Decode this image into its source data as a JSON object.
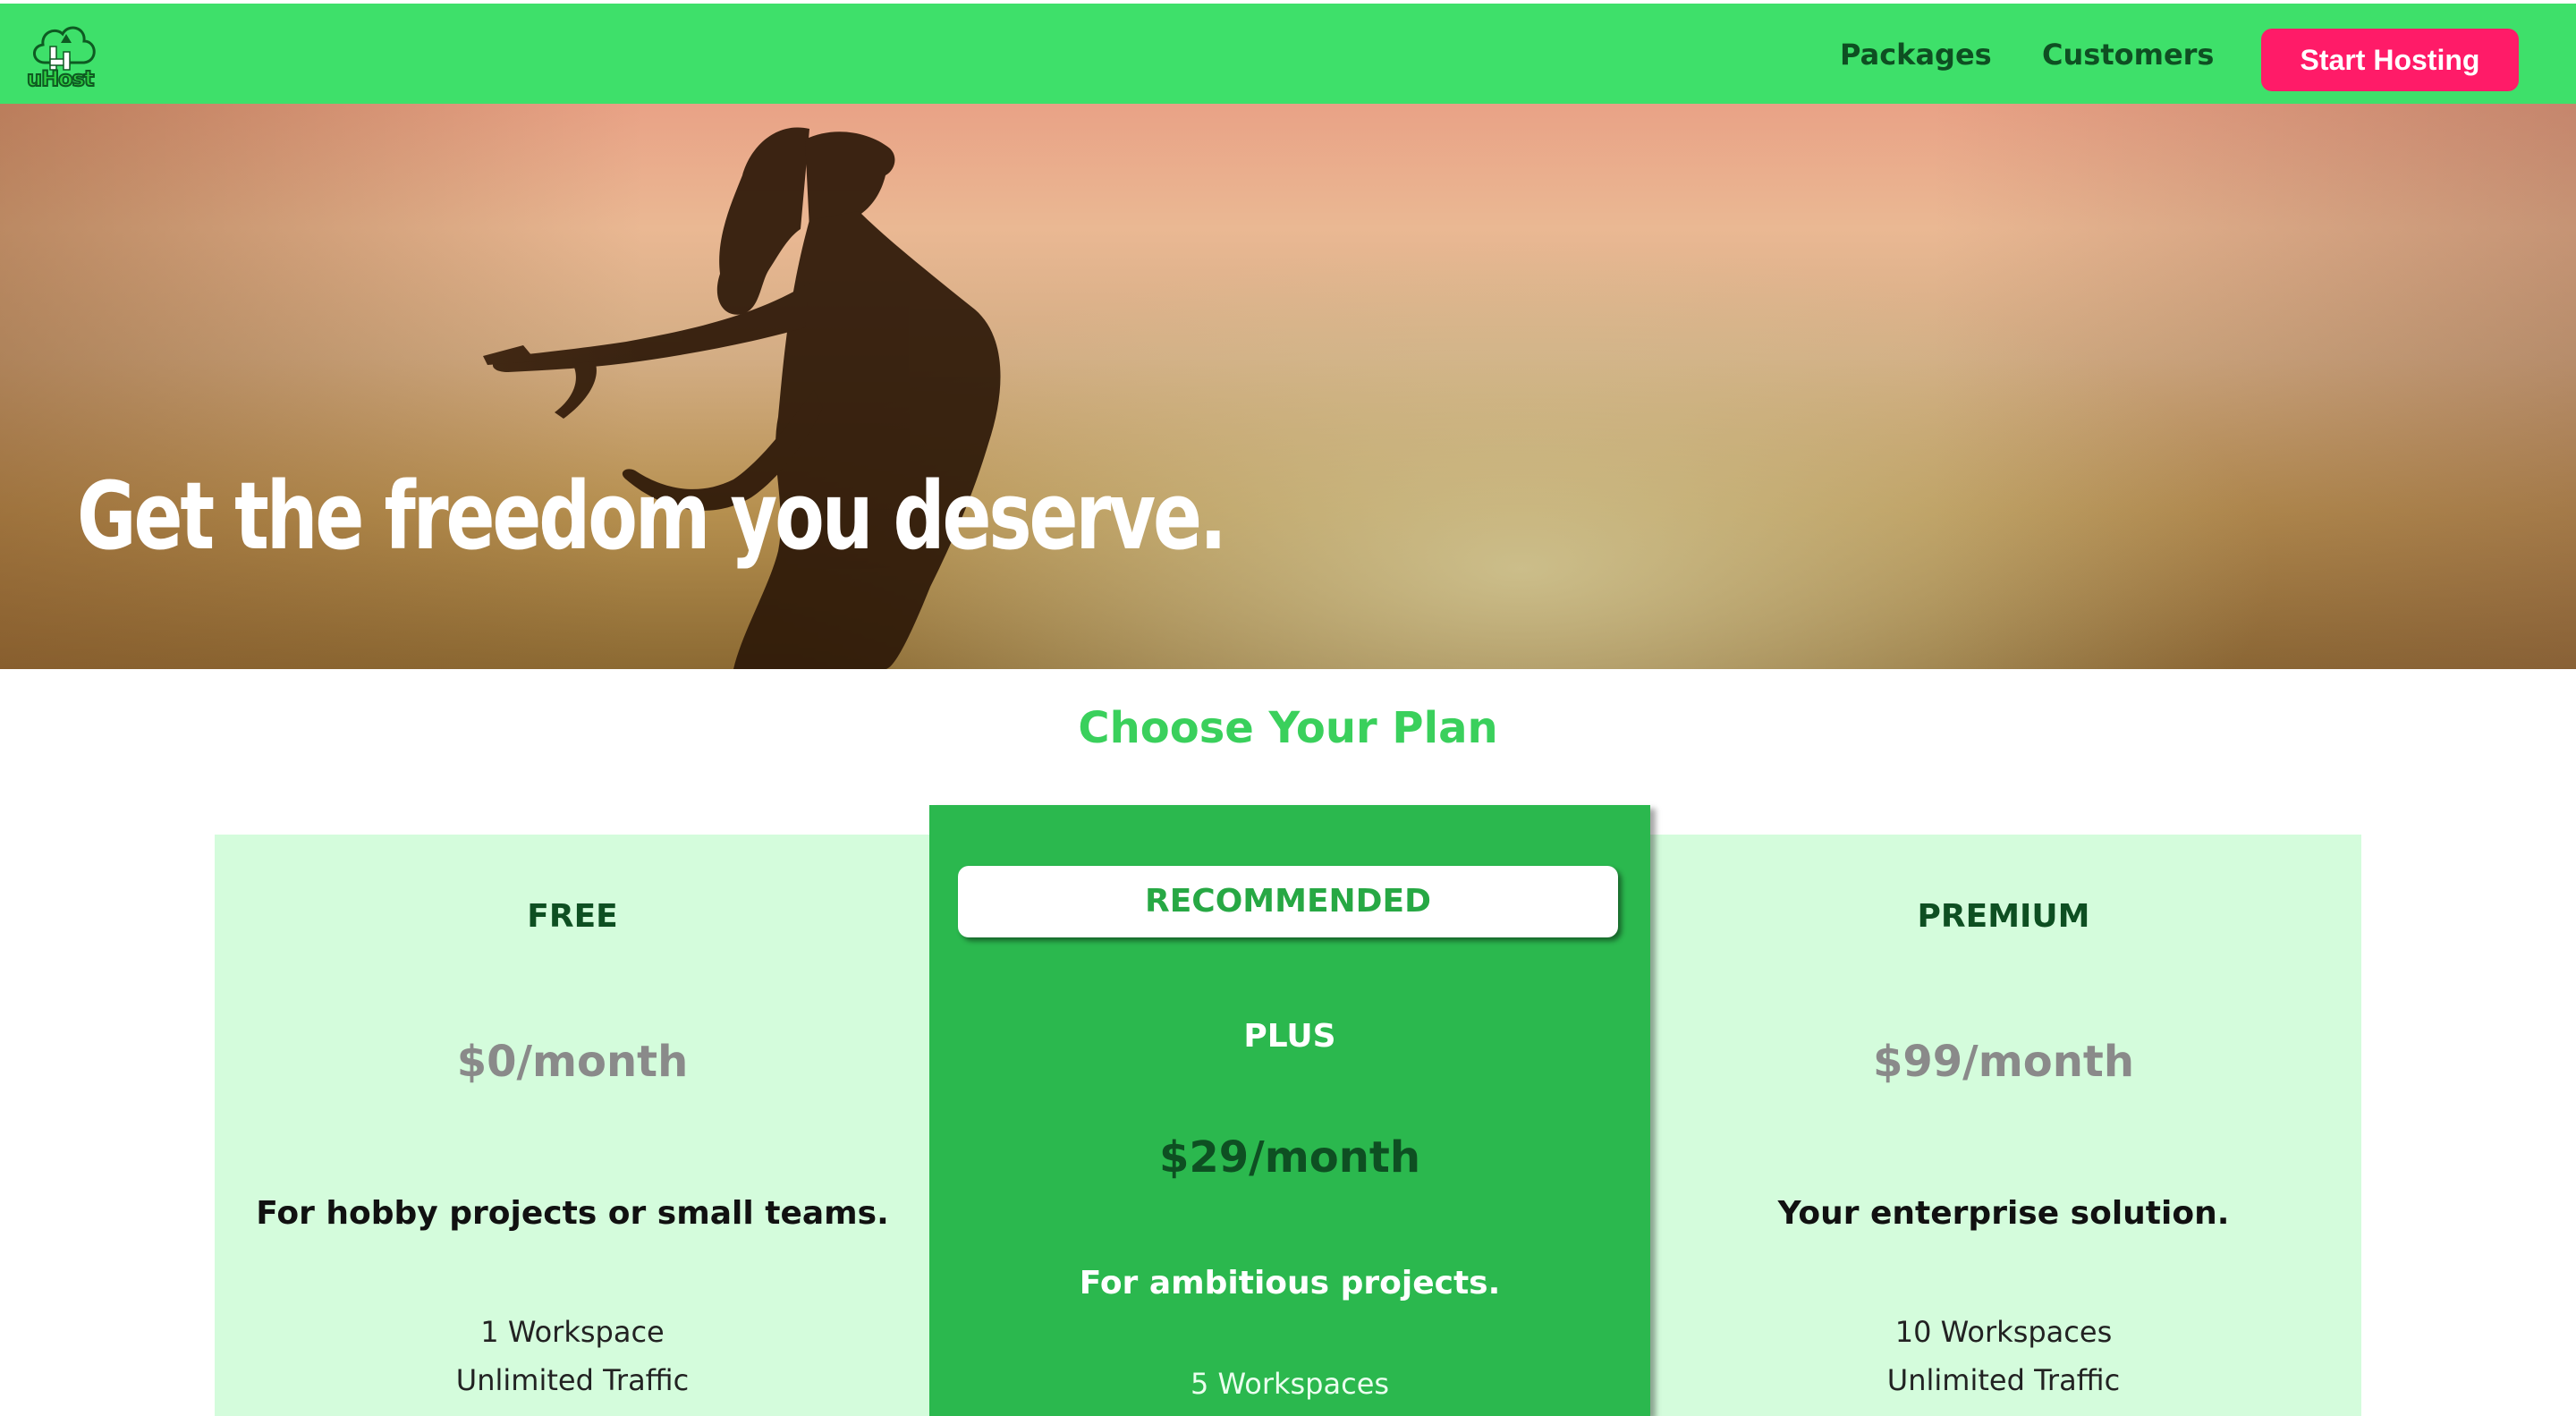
{
  "header": {
    "logo_text": "uHost",
    "nav": [
      {
        "label": "Packages"
      },
      {
        "label": "Customers"
      }
    ],
    "cta_label": "Start Hosting"
  },
  "hero": {
    "title": "Get the freedom you deserve."
  },
  "plans_section": {
    "title": "Choose Your Plan",
    "plans": [
      {
        "name": "FREE",
        "price": "$0/month",
        "description": "For hobby projects or small teams.",
        "features": [
          "1 Workspace",
          "Unlimited Traffic"
        ]
      },
      {
        "badge": "RECOMMENDED",
        "name": "PLUS",
        "price": "$29/month",
        "description": "For ambitious projects.",
        "features": [
          "5 Workspaces"
        ]
      },
      {
        "name": "PREMIUM",
        "price": "$99/month",
        "description": "Your enterprise solution.",
        "features": [
          "10 Workspaces",
          "Unlimited Traffic"
        ]
      }
    ]
  },
  "colors": {
    "header_bg": "#3ee06a",
    "cta_bg": "#ff1b68",
    "accent_green": "#2bb84e",
    "plan_bg": "#d4fcdc"
  }
}
